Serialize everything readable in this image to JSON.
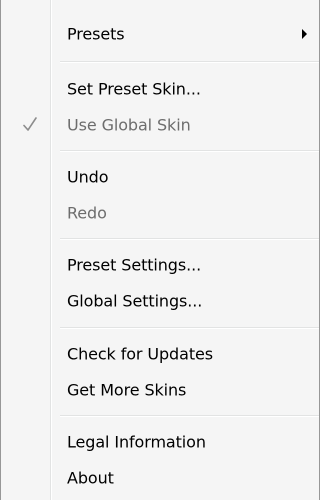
{
  "menu": {
    "items": [
      {
        "label": "Presets",
        "enabled": true,
        "submenu": true
      },
      {
        "label": "Set Preset Skin...",
        "enabled": true
      },
      {
        "label": "Use Global Skin",
        "enabled": false,
        "checked": true
      },
      {
        "label": "Undo",
        "enabled": true
      },
      {
        "label": "Redo",
        "enabled": false
      },
      {
        "label": "Preset Settings...",
        "enabled": true
      },
      {
        "label": "Global Settings...",
        "enabled": true
      },
      {
        "label": "Check for Updates",
        "enabled": true
      },
      {
        "label": "Get More Skins",
        "enabled": true
      },
      {
        "label": "Legal Information",
        "enabled": true
      },
      {
        "label": "About",
        "enabled": true
      }
    ]
  },
  "colors": {
    "background": "#f5f5f5",
    "border": "#979797",
    "text": "#000000",
    "disabled_text": "#6d6d6d",
    "separator": "#e2e3e3"
  }
}
